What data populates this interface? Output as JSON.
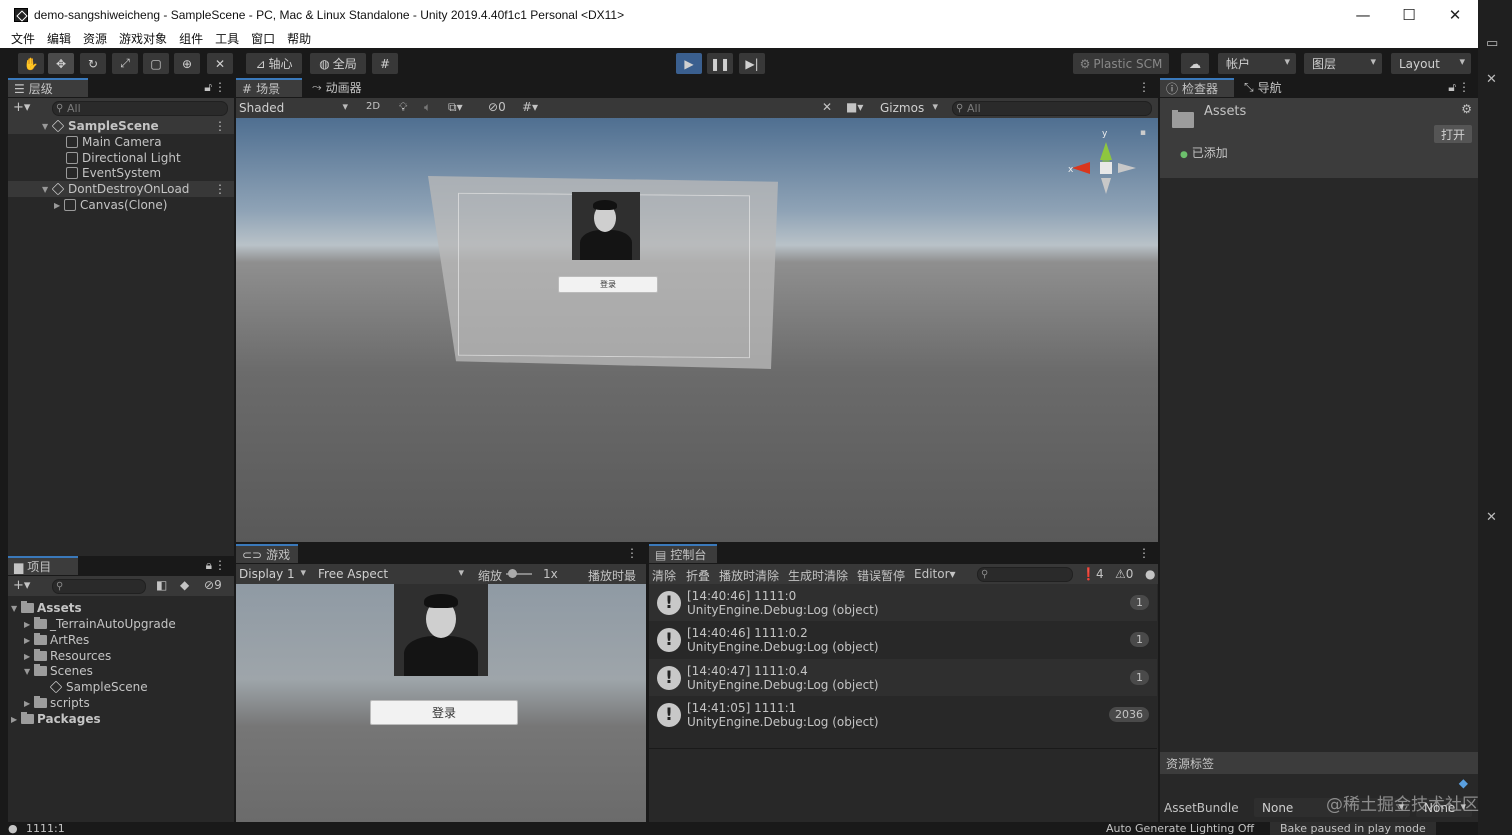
{
  "window": {
    "title": "demo-sangshiweicheng - SampleScene - PC, Mac & Linux Standalone - Unity 2019.4.40f1c1 Personal <DX11>",
    "minimize": "—",
    "maximize": "☐",
    "close": "✕"
  },
  "menu": [
    "文件",
    "编辑",
    "资源",
    "游戏对象",
    "组件",
    "工具",
    "窗口",
    "帮助"
  ],
  "toolbar": {
    "pivot": "轴心",
    "global": "全局",
    "plastic": "Plastic SCM",
    "account": "帐户",
    "layers": "图层",
    "layout": "Layout"
  },
  "hierarchy": {
    "tab": "层级",
    "add": "+▾",
    "search_placeholder": "All",
    "items": [
      {
        "label": "SampleScene"
      },
      {
        "label": "Main Camera"
      },
      {
        "label": "Directional Light"
      },
      {
        "label": "EventSystem"
      },
      {
        "label": "DontDestroyOnLoad"
      },
      {
        "label": "Canvas(Clone)"
      }
    ]
  },
  "scene": {
    "tab_scene": "场景",
    "tab_animator": "动画器",
    "shading": "Shaded",
    "mode2d": "2D",
    "hidden_count": "0",
    "gizmos": "Gizmos",
    "search_placeholder": "All",
    "button_text": "登录",
    "axis_x": "x",
    "axis_y": "y"
  },
  "game": {
    "tab": "游戏",
    "display": "Display 1",
    "aspect": "Free Aspect",
    "scale_label": "缩放",
    "scale_value": "1x",
    "maximize": "播放时最大",
    "login_button": "登录"
  },
  "console": {
    "tab": "控制台",
    "clear": "清除",
    "collapse": "折叠",
    "clear_on_play": "播放时清除",
    "clear_on_build": "生成时清除",
    "error_pause": "错误暂停",
    "editor": "Editor",
    "warn_count": "4",
    "error_count": "0",
    "entries": [
      {
        "line1": "[14:40:46] 1111:0",
        "line2": "UnityEngine.Debug:Log (object)",
        "count": "1"
      },
      {
        "line1": "[14:40:46] 1111:0.2",
        "line2": "UnityEngine.Debug:Log (object)",
        "count": "1"
      },
      {
        "line1": "[14:40:47] 1111:0.4",
        "line2": "UnityEngine.Debug:Log (object)",
        "count": "1"
      },
      {
        "line1": "[14:41:05] 1111:1",
        "line2": "UnityEngine.Debug:Log (object)",
        "count": "2036"
      }
    ]
  },
  "project": {
    "tab": "项目",
    "add": "+▾",
    "hidden_count": "9",
    "items": [
      {
        "label": "Assets"
      },
      {
        "label": "_TerrainAutoUpgrade"
      },
      {
        "label": "ArtRes"
      },
      {
        "label": "Resources"
      },
      {
        "label": "Scenes"
      },
      {
        "label": "SampleScene"
      },
      {
        "label": "scripts"
      },
      {
        "label": "Packages"
      }
    ]
  },
  "inspector": {
    "tab": "检查器",
    "tab_nav": "导航",
    "asset_name": "Assets",
    "open_button": "打开",
    "added": "已添加",
    "labels_title": "资源标签",
    "assetbundle_label": "AssetBundle",
    "assetbundle_value": "None",
    "variant_value": "None"
  },
  "status": {
    "message": "1111:1",
    "lighting": "Auto Generate Lighting Off",
    "bake": "Bake paused in play mode"
  },
  "watermark": "@稀土掘金技术社区"
}
